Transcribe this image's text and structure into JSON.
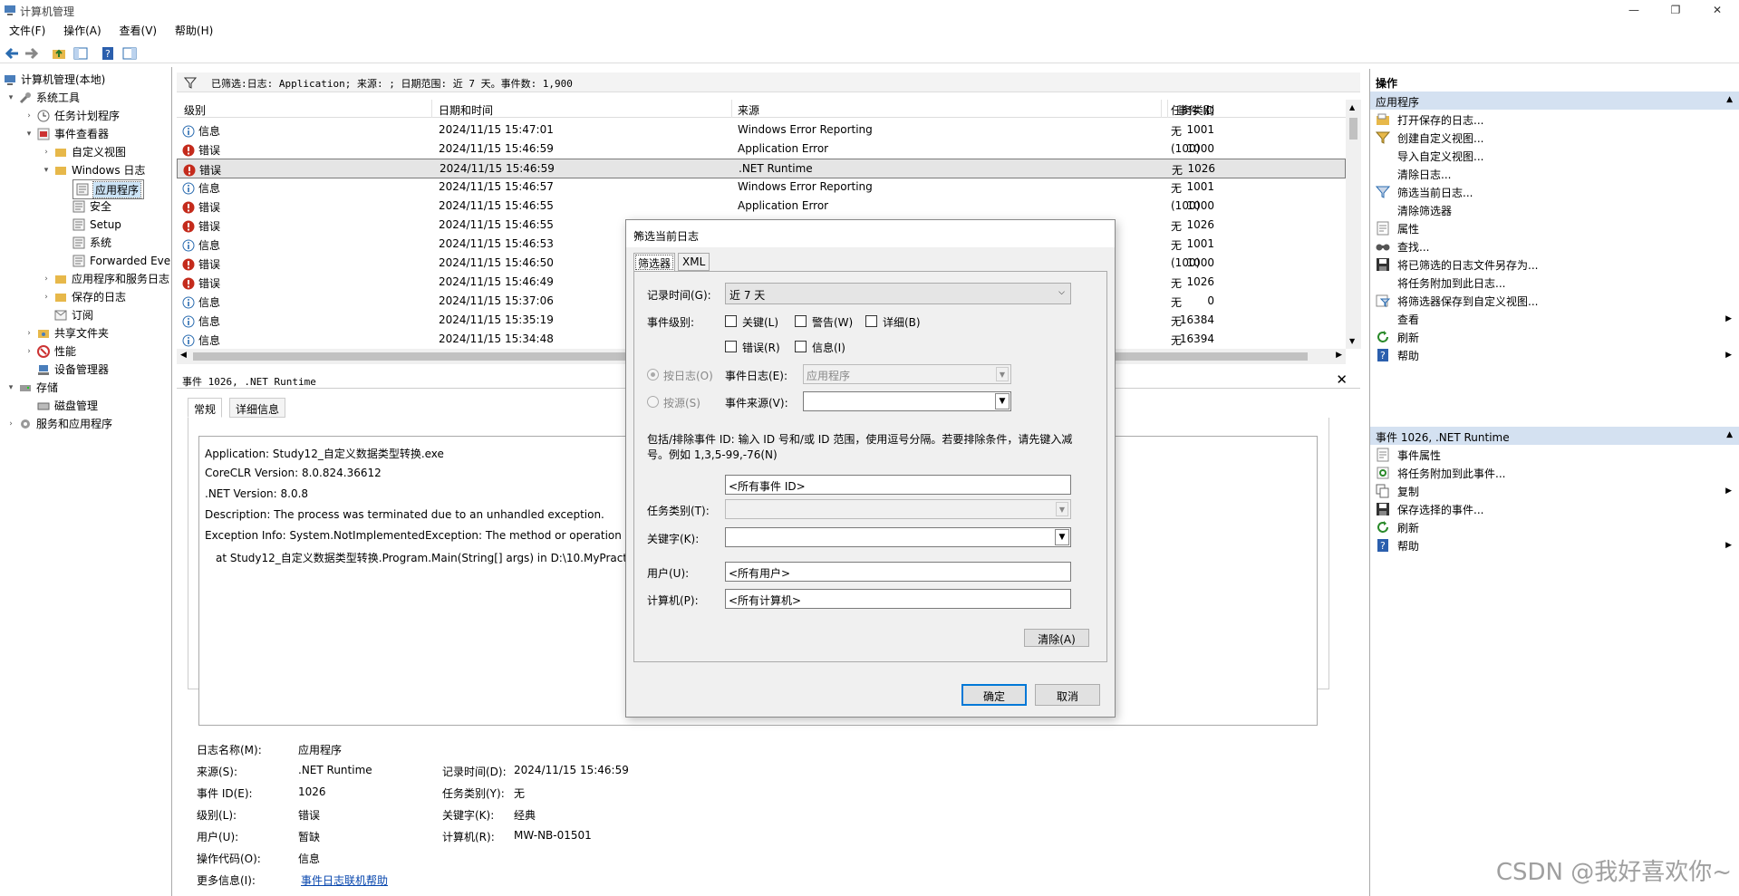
{
  "window": {
    "title": "计算机管理"
  },
  "menu": [
    "文件(F)",
    "操作(A)",
    "查看(V)",
    "帮助(H)"
  ],
  "tree": [
    {
      "label": "计算机管理(本地)",
      "icon": "computer-icon",
      "exp": ""
    },
    {
      "label": "系统工具",
      "icon": "tools-icon",
      "exp": "▾"
    },
    {
      "label": "任务计划程序",
      "icon": "clock-icon",
      "exp": "›"
    },
    {
      "label": "事件查看器",
      "icon": "event-viewer-icon",
      "exp": "▾"
    },
    {
      "label": "自定义视图",
      "icon": "folder-icon",
      "exp": "›"
    },
    {
      "label": "Windows 日志",
      "icon": "folder-icon",
      "exp": "▾"
    },
    {
      "label": "应用程序",
      "icon": "log-icon",
      "exp": ""
    },
    {
      "label": "安全",
      "icon": "log-icon",
      "exp": ""
    },
    {
      "label": "Setup",
      "icon": "log-icon",
      "exp": ""
    },
    {
      "label": "系统",
      "icon": "log-icon",
      "exp": ""
    },
    {
      "label": "Forwarded Eve",
      "icon": "log-icon",
      "exp": ""
    },
    {
      "label": "应用程序和服务日志",
      "icon": "folder-icon",
      "exp": "›"
    },
    {
      "label": "保存的日志",
      "icon": "folder-icon",
      "exp": "›"
    },
    {
      "label": "订阅",
      "icon": "subscription-icon",
      "exp": ""
    },
    {
      "label": "共享文件夹",
      "icon": "shared-folder-icon",
      "exp": "›"
    },
    {
      "label": "性能",
      "icon": "performance-icon",
      "exp": "›"
    },
    {
      "label": "设备管理器",
      "icon": "device-manager-icon",
      "exp": ""
    },
    {
      "label": "存储",
      "icon": "storage-icon",
      "exp": "▾"
    },
    {
      "label": "磁盘管理",
      "icon": "disk-icon",
      "exp": ""
    },
    {
      "label": "服务和应用程序",
      "icon": "services-icon",
      "exp": "›"
    }
  ],
  "filter": {
    "summary": "已筛选:日志: Application; 来源: ; 日期范围: 近 7 天。事件数: 1,900"
  },
  "list": {
    "headers": [
      "级别",
      "日期和时间",
      "来源",
      "事件 ID",
      "任务类别"
    ],
    "rows": [
      {
        "level": "信息",
        "type": "info",
        "datetime": "2024/11/15 15:47:01",
        "source": "Windows Error Reporting",
        "id": "1001",
        "task": "无"
      },
      {
        "level": "错误",
        "type": "error",
        "datetime": "2024/11/15 15:46:59",
        "source": "Application Error",
        "id": "1000",
        "task": "(100)"
      },
      {
        "level": "错误",
        "type": "error",
        "datetime": "2024/11/15 15:46:59",
        "source": ".NET Runtime",
        "id": "1026",
        "task": "无"
      },
      {
        "level": "信息",
        "type": "info",
        "datetime": "2024/11/15 15:46:57",
        "source": "Windows Error Reporting",
        "id": "1001",
        "task": "无"
      },
      {
        "level": "错误",
        "type": "error",
        "datetime": "2024/11/15 15:46:55",
        "source": "Application Error",
        "id": "1000",
        "task": "(100)"
      },
      {
        "level": "错误",
        "type": "error",
        "datetime": "2024/11/15 15:46:55",
        "source": "",
        "id": "1026",
        "task": "无"
      },
      {
        "level": "信息",
        "type": "info",
        "datetime": "2024/11/15 15:46:53",
        "source": "",
        "id": "1001",
        "task": "无"
      },
      {
        "level": "错误",
        "type": "error",
        "datetime": "2024/11/15 15:46:50",
        "source": "",
        "id": "1000",
        "task": "(100)"
      },
      {
        "level": "错误",
        "type": "error",
        "datetime": "2024/11/15 15:46:49",
        "source": "",
        "id": "1026",
        "task": "无"
      },
      {
        "level": "信息",
        "type": "info",
        "datetime": "2024/11/15 15:37:06",
        "source": "",
        "id": "0",
        "task": "无"
      },
      {
        "level": "信息",
        "type": "info",
        "datetime": "2024/11/15 15:35:19",
        "source": "",
        "id": "16384",
        "task": "无"
      },
      {
        "level": "信息",
        "type": "info",
        "datetime": "2024/11/15 15:34:48",
        "source": "",
        "id": "16394",
        "task": "无"
      }
    ]
  },
  "detail": {
    "header": "事件 1026, .NET Runtime",
    "tabs": [
      "常规",
      "详细信息"
    ],
    "lines": [
      "Application: Study12_自定义数据类型转换.exe",
      "CoreCLR Version: 8.0.824.36612",
      ".NET Version: 8.0.8",
      "Description: The process was terminated due to an unhandled exception.",
      "Exception Info: System.NotImplementedException: The method or operation is n",
      "   at Study12_自定义数据类型转换.Program.Main(String[] args) in D:\\10.MyPractice"
    ],
    "log_name_label": "日志名称(M):",
    "log_name": "应用程序",
    "source_label": "来源(S):",
    "source": ".NET Runtime",
    "logged_label": "记录时间(D):",
    "logged": "2024/11/15 15:46:59",
    "event_id_label": "事件 ID(E):",
    "event_id": "1026",
    "task_label": "任务类别(Y):",
    "task": "无",
    "level_label": "级别(L):",
    "level": "错误",
    "keywords_label": "关键字(K):",
    "keywords": "经典",
    "user_label": "用户(U):",
    "user": "暂缺",
    "computer_label": "计算机(R):",
    "computer": "MW-NB-01501",
    "opcode_label": "操作代码(O):",
    "opcode": "信息",
    "more_label": "更多信息(I):",
    "more_link": "事件日志联机帮助"
  },
  "actions": {
    "title": "操作",
    "group1": "应用程序",
    "items1": [
      {
        "label": "打开保存的日志...",
        "icon": "open-log-icon",
        "arrow": false
      },
      {
        "label": "创建自定义视图...",
        "icon": "filter-create-icon",
        "arrow": false
      },
      {
        "label": "导入自定义视图...",
        "icon": "",
        "arrow": false
      },
      {
        "label": "清除日志...",
        "icon": "",
        "arrow": false
      },
      {
        "label": "筛选当前日志...",
        "icon": "filter-icon",
        "arrow": false
      },
      {
        "label": "清除筛选器",
        "icon": "",
        "arrow": false
      },
      {
        "label": "属性",
        "icon": "properties-icon",
        "arrow": false
      },
      {
        "label": "查找...",
        "icon": "find-icon",
        "arrow": false
      },
      {
        "label": "将已筛选的日志文件另存为...",
        "icon": "save-icon",
        "arrow": false
      },
      {
        "label": "将任务附加到此日志...",
        "icon": "",
        "arrow": false
      },
      {
        "label": "将筛选器保存到自定义视图...",
        "icon": "save-filter-icon",
        "arrow": false
      },
      {
        "label": "查看",
        "icon": "",
        "arrow": true
      },
      {
        "label": "刷新",
        "icon": "refresh-icon",
        "arrow": false
      },
      {
        "label": "帮助",
        "icon": "help-icon",
        "arrow": true
      }
    ],
    "group2": "事件 1026, .NET Runtime",
    "items2": [
      {
        "label": "事件属性",
        "icon": "properties-icon",
        "arrow": false
      },
      {
        "label": "将任务附加到此事件...",
        "icon": "task-icon",
        "arrow": false
      },
      {
        "label": "复制",
        "icon": "copy-icon",
        "arrow": true
      },
      {
        "label": "保存选择的事件...",
        "icon": "save-icon",
        "arrow": false
      },
      {
        "label": "刷新",
        "icon": "refresh-icon",
        "arrow": false
      },
      {
        "label": "帮助",
        "icon": "help-icon",
        "arrow": true
      }
    ]
  },
  "dialog": {
    "title": "筛选当前日志",
    "tabs": [
      "筛选器",
      "XML"
    ],
    "logged_label": "记录时间(G):",
    "logged_value": "近 7 天",
    "level_label": "事件级别:",
    "levels": [
      "关键(L)",
      "警告(W)",
      "详细(B)",
      "错误(R)",
      "信息(I)"
    ],
    "by_log": "按日志(O)",
    "by_source": "按源(S)",
    "event_logs_label": "事件日志(E):",
    "event_logs_value": "应用程序",
    "event_sources_label": "事件来源(V):",
    "desc": "包括/排除事件 ID: 输入 ID 号和/或 ID 范围，使用逗号分隔。若要排除条件，请先键入减号。例如 1,3,5-99,-76(N)",
    "event_id_value": "<所有事件 ID>",
    "task_label": "任务类别(T):",
    "keywords_label": "关键字(K):",
    "user_label": "用户(U):",
    "user_value": "<所有用户>",
    "computer_label": "计算机(P):",
    "computer_value": "<所有计算机>",
    "clear": "清除(A)",
    "ok": "确定",
    "cancel": "取消"
  },
  "watermark": "CSDN @我好喜欢你~"
}
